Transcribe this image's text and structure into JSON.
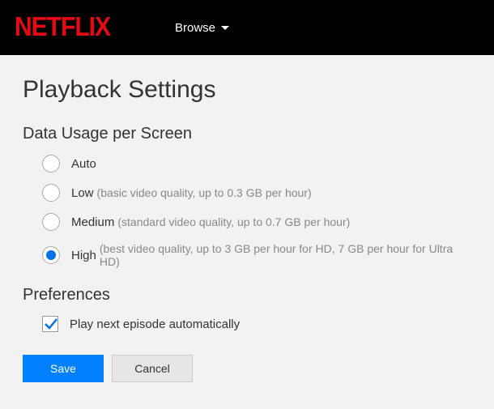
{
  "header": {
    "logo_text": "NETFLIX",
    "browse_label": "Browse"
  },
  "page": {
    "title": "Playback Settings"
  },
  "data_usage": {
    "heading": "Data Usage per Screen",
    "options": [
      {
        "label": "Auto",
        "desc": "",
        "selected": false
      },
      {
        "label": "Low",
        "desc": "(basic video quality, up to 0.3 GB per hour)",
        "selected": false
      },
      {
        "label": "Medium",
        "desc": "(standard video quality, up to 0.7 GB per hour)",
        "selected": false
      },
      {
        "label": "High",
        "desc": "(best video quality, up to 3 GB per hour for HD, 7 GB per hour for Ultra HD)",
        "selected": true
      }
    ]
  },
  "preferences": {
    "heading": "Preferences",
    "autoplay_label": "Play next episode automatically",
    "autoplay_checked": true
  },
  "buttons": {
    "save": "Save",
    "cancel": "Cancel"
  }
}
